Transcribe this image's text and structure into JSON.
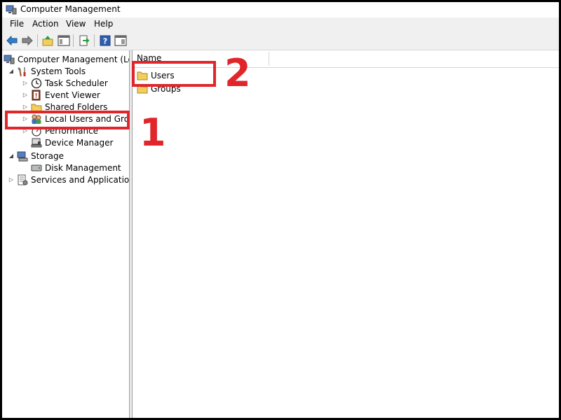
{
  "window": {
    "title": "Computer Management"
  },
  "menu": [
    "File",
    "Action",
    "View",
    "Help"
  ],
  "toolbar": {
    "buttons": [
      "back-icon",
      "forward-icon",
      "up-icon",
      "show-hide-tree-icon",
      "export-list-icon",
      "help-icon",
      "properties-icon"
    ]
  },
  "tree": {
    "root": "Computer Management (Local",
    "system_tools": "System Tools",
    "task_scheduler": "Task Scheduler",
    "event_viewer": "Event Viewer",
    "shared_folders": "Shared Folders",
    "local_users": "Local Users and Groups",
    "performance": "Performance",
    "device_manager": "Device Manager",
    "storage": "Storage",
    "disk_management": "Disk Management",
    "services": "Services and Applications"
  },
  "list": {
    "column_name": "Name",
    "items": [
      "Users",
      "Groups"
    ]
  },
  "annotations": {
    "step1": "1",
    "step2": "2",
    "color": "#e0262b"
  }
}
